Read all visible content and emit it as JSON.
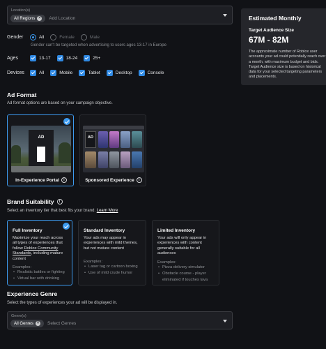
{
  "location": {
    "label": "Location(s)",
    "chip": "All Regions",
    "placeholder": "Add Location"
  },
  "gender": {
    "label": "Gender",
    "options": [
      "All",
      "Female",
      "Male"
    ],
    "selected": "All",
    "note": "Gender can't be targeted when advertising to users ages 13-17 in Europe"
  },
  "ages": {
    "label": "Ages",
    "options": [
      "13-17",
      "18-24",
      "25+"
    ]
  },
  "devices": {
    "label": "Devices",
    "options": [
      "All",
      "Mobile",
      "Tablet",
      "Desktop",
      "Console"
    ]
  },
  "estimate": {
    "title": "Estimated Monthly",
    "subtitle": "Target Audience Size",
    "range": "67M - 82M",
    "description": "The approximate number of Roblox user accounts your ad could potentially reach over a month, with maximum budget and bids. Target Audience size is based on historical data for your selected targeting parameters and placements."
  },
  "ad_format": {
    "heading": "Ad Format",
    "desc": "Ad format options are based on your campaign objective.",
    "options": [
      {
        "label": "In-Experience Portal",
        "badge": "AD",
        "selected": true
      },
      {
        "label": "Sponsored Experience",
        "badge": "AD",
        "selected": false
      }
    ]
  },
  "brand": {
    "heading": "Brand Suitability",
    "desc": "Select an inventory tier that best fits your brand.",
    "link": "Learn More",
    "examples_label": "Examples:",
    "tiers": [
      {
        "title": "Full Inventory",
        "desc": "Maximize your reach across all types of experiences that follow",
        "link": "Roblox Community Standards",
        "desc_tail": ", including mature content",
        "examples": [
          "Realistic battles or fighting",
          "Virtual bar with drinking"
        ],
        "selected": true
      },
      {
        "title": "Standard Inventory",
        "desc": "Your ads may appear in experiences with mild themes, but not mature content",
        "examples": [
          "Laser tag or cartoon boxing",
          "Use of mild crude humor"
        ],
        "selected": false
      },
      {
        "title": "Limited Inventory",
        "desc": "Your ads will only appear in experiences with content generally suitable for all audiences",
        "examples": [
          "Pizza delivery simulator",
          "Obstacle course - player eliminated if touches lava"
        ],
        "selected": false
      }
    ]
  },
  "genre": {
    "heading": "Experience Genre",
    "desc": "Select the types of experiences your ad will be displayed in.",
    "label": "Genre(s)",
    "chip": "All Genres",
    "placeholder": "Select Genres"
  },
  "colors": {
    "accent": "#3d9bf0",
    "background": "#111216",
    "panel": "#25262b"
  }
}
